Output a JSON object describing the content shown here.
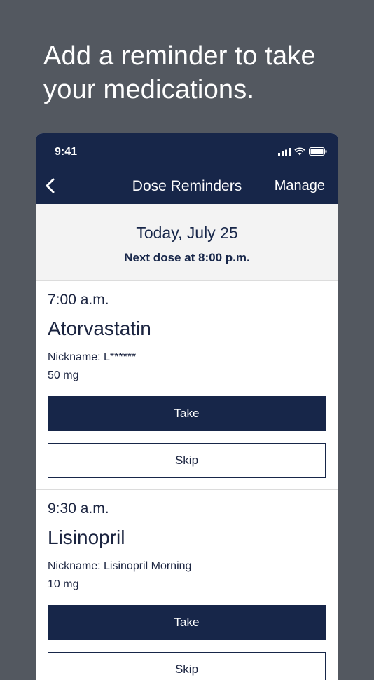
{
  "headline": "Add a reminder to take your medications.",
  "status": {
    "time": "9:41"
  },
  "nav": {
    "title": "Dose Reminders",
    "manage_label": "Manage"
  },
  "summary": {
    "date": "Today, July 25",
    "next_dose": "Next dose at 8:00 p.m."
  },
  "doses": [
    {
      "time": "7:00 a.m.",
      "name": "Atorvastatin",
      "nickname": "Nickname: L******",
      "strength": "50 mg",
      "take_label": "Take",
      "skip_label": "Skip"
    },
    {
      "time": "9:30 a.m.",
      "name": "Lisinopril",
      "nickname": "Nickname: Lisinopril Morning",
      "strength": "10 mg",
      "take_label": "Take",
      "skip_label": "Skip"
    }
  ],
  "colors": {
    "background": "#535860",
    "navy": "#172649"
  }
}
